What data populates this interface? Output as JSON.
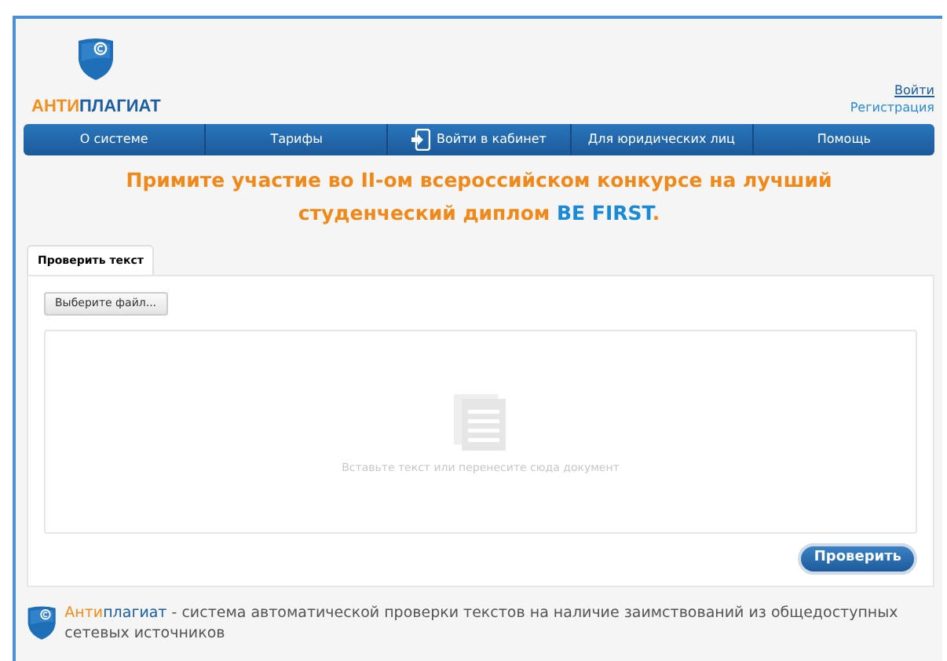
{
  "logo": {
    "part_1": "АНТИ",
    "part_2": "ПЛАГИАТ"
  },
  "account_links": [
    "Войти",
    "Регистрация"
  ],
  "nav": [
    {
      "label": "О системе",
      "kind": "link"
    },
    {
      "label": "Тарифы",
      "kind": "link"
    },
    {
      "label": "Войти в кабинет",
      "kind": "login"
    },
    {
      "label": "Для юридических лиц",
      "kind": "link"
    },
    {
      "label": "Помощь",
      "kind": "link"
    }
  ],
  "headline": [
    {
      "text": "Примите участие во II-ом всероссийском конкурсе на лучший студенческий диплом ",
      "kind": "plain"
    },
    {
      "text": "BE FIRST",
      "kind": "accent"
    },
    {
      "text": ".",
      "kind": "plain"
    }
  ],
  "tabs": [
    {
      "label": "Проверить текст",
      "selected": true
    }
  ],
  "choose_file_button": "Выберите файл...",
  "text_area": {
    "placeholder": "Вставьте текст или перенесите сюда документ"
  },
  "check_button": "Проверить",
  "footer": {
    "part_1": "Анти",
    "part_2": "плагиат",
    "part_3": " - система автоматической проверки текстов на наличие заимствований из общедоступных сетевых источников"
  }
}
